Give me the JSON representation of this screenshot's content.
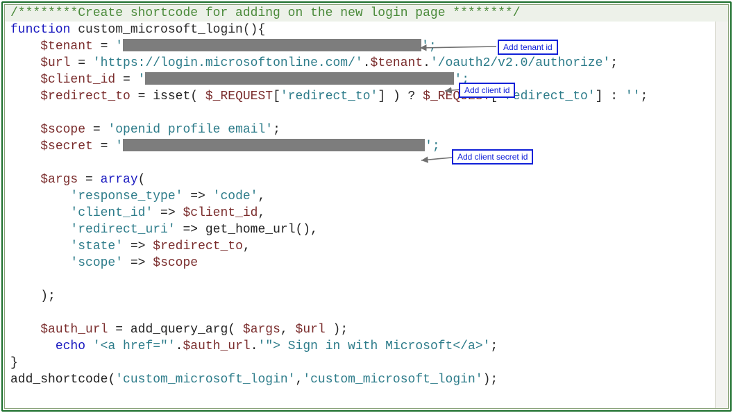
{
  "code": {
    "comment": "/********Create shortcode for adding on the new login page ********/",
    "l1_function": "function",
    "l1_name": " custom_microsoft_login(){",
    "l2_p1": "    ",
    "l2_var": "$tenant",
    "l2_eq": " = ",
    "l2_q1": "'",
    "l2_qend": "';",
    "l3_p1": "    ",
    "l3_var": "$url",
    "l3_eq": " = ",
    "l3_s1": "'https://login.microsoftonline.com/'",
    "l3_dot1": ".",
    "l3_var2": "$tenant",
    "l3_dot2": ".",
    "l3_s2": "'/oauth2/v2.0/authorize'",
    "l3_semi": ";",
    "l4_p1": "    ",
    "l4_var": "$client_id",
    "l4_eq": " = ",
    "l4_q1": "'",
    "l4_qend": "';",
    "l5_p1": "    ",
    "l5_var": "$redirect_to",
    "l5_eq": " = isset( ",
    "l5_req1": "$_REQUEST",
    "l5_br1": "[",
    "l5_key": "'redirect_to'",
    "l5_br2": "] ) ? ",
    "l5_req2": "$_REQUEST",
    "l5_br3": "[",
    "l5_key2": "'redirect_to'",
    "l5_br4": "] : ",
    "l5_empty": "''",
    "l5_semi": ";",
    "l7_p1": "    ",
    "l7_var": "$scope",
    "l7_eq": " = ",
    "l7_s": "'openid profile email'",
    "l7_semi": ";",
    "l8_p1": "    ",
    "l8_var": "$secret",
    "l8_eq": " = ",
    "l8_q1": "'",
    "l8_qend": "';",
    "l10_p1": "    ",
    "l10_var": "$args",
    "l10_eq": " = ",
    "l10_arr": "array",
    "l10_open": "(",
    "l11_p": "        ",
    "l11_k": "'response_type'",
    "l11_arw": " => ",
    "l11_v": "'code'",
    "l11_c": ",",
    "l12_p": "        ",
    "l12_k": "'client_id'",
    "l12_arw": " => ",
    "l12_v": "$client_id",
    "l12_c": ",",
    "l13_p": "        ",
    "l13_k": "'redirect_uri'",
    "l13_arw": " => ",
    "l13_fn": "get_home_url",
    "l13_call": "(),",
    "l14_p": "        ",
    "l14_k": "'state'",
    "l14_arw": " => ",
    "l14_v": "$redirect_to",
    "l14_c": ",",
    "l15_p": "        ",
    "l15_k": "'scope'",
    "l15_arw": " => ",
    "l15_v": "$scope",
    "l17_close": "    );",
    "l19_p1": "    ",
    "l19_var": "$auth_url",
    "l19_eq": " = ",
    "l19_fn": "add_query_arg",
    "l19_open": "( ",
    "l19_a1": "$args",
    "l19_comma": ", ",
    "l19_a2": "$url",
    "l19_close": " );",
    "l20_p": "      ",
    "l20_echo": "echo",
    "l20_sp": " ",
    "l20_s1": "'<a href=\"'",
    "l20_dot1": ".",
    "l20_var": "$auth_url",
    "l20_dot2": ".",
    "l20_s2": "'\"> Sign in with Microsoft</a>'",
    "l20_semi": ";",
    "l21_brace": "}",
    "l22_fn": "add_shortcode",
    "l22_open": "(",
    "l22_a1": "'custom_microsoft_login'",
    "l22_comma": ",",
    "l22_a2": "'custom_microsoft_login'",
    "l22_close": ");"
  },
  "callouts": {
    "tenant": "Add tenant id",
    "client": "Add client id",
    "secret": "Add client secret id"
  }
}
